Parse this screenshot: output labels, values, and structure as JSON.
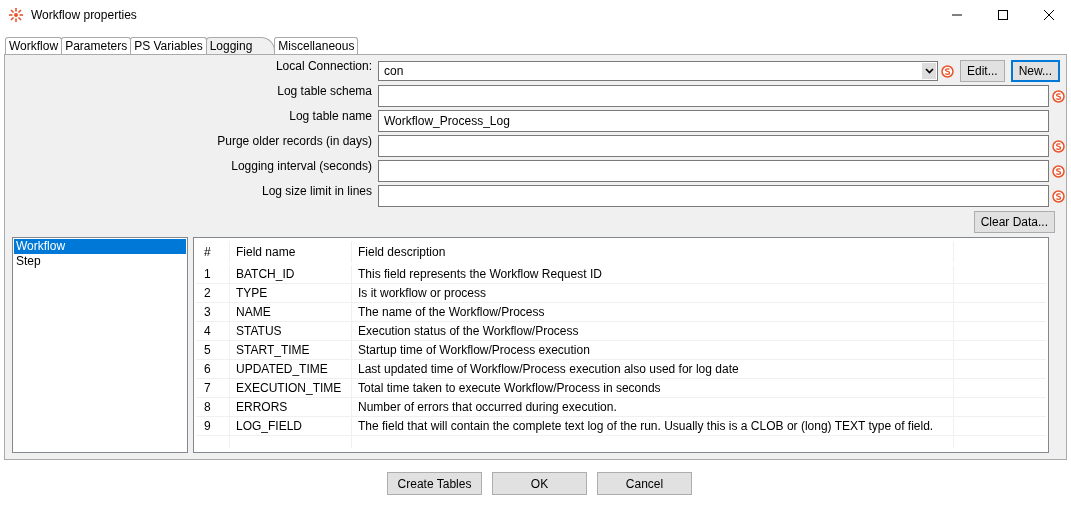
{
  "window": {
    "title": "Workflow properties"
  },
  "tabs": [
    {
      "label": "Workflow",
      "selected": false
    },
    {
      "label": "Parameters",
      "selected": false
    },
    {
      "label": "PS Variables",
      "selected": false
    },
    {
      "label": "Logging",
      "selected": true
    },
    {
      "label": "Miscellaneous",
      "selected": false
    }
  ],
  "form": [
    {
      "kind": "select",
      "label": "Local Connection:",
      "value": "con",
      "variable": true,
      "buttons": [
        {
          "label": "Edit...",
          "focused": false
        },
        {
          "label": "New...",
          "focused": true
        }
      ]
    },
    {
      "kind": "text",
      "label": "Log table schema",
      "variable": true
    },
    {
      "kind": "text",
      "label": "Log table name",
      "value": "Workflow_Process_Log",
      "variable": false
    },
    {
      "kind": "text",
      "label": "Purge older records (in days)",
      "variable": true
    },
    {
      "kind": "text",
      "label": "Logging interval (seconds)",
      "variable": true
    },
    {
      "kind": "text",
      "label": "Log size limit in lines",
      "variable": true
    }
  ],
  "clear_button": "Clear Data...",
  "sidebar": {
    "items": [
      {
        "label": "Workflow",
        "selected": true
      },
      {
        "label": "Step",
        "selected": false
      }
    ]
  },
  "table": {
    "columns": [
      "#",
      "Field name",
      "Field description"
    ],
    "rows": [
      [
        "1",
        "BATCH_ID",
        "This field represents the Workflow Request ID"
      ],
      [
        "2",
        "TYPE",
        "Is it workflow or process"
      ],
      [
        "3",
        "NAME",
        "The name of the Workflow/Process"
      ],
      [
        "4",
        "STATUS",
        "Execution status of the Workflow/Process"
      ],
      [
        "5",
        "START_TIME",
        "Startup time of Workflow/Process execution"
      ],
      [
        "6",
        "UPDATED_TIME",
        "Last updated time of Workflow/Process execution also used for log date"
      ],
      [
        "7",
        "EXECUTION_TIME",
        "Total time taken to execute Workflow/Process in seconds"
      ],
      [
        "8",
        "ERRORS",
        "Number of errors that occurred during execution."
      ],
      [
        "9",
        "LOG_FIELD",
        "The field that will contain the complete text log of the run.  Usually this is a CLOB or (long) TEXT type of field."
      ]
    ]
  },
  "buttons": [
    "Create Tables",
    "OK",
    "Cancel"
  ]
}
